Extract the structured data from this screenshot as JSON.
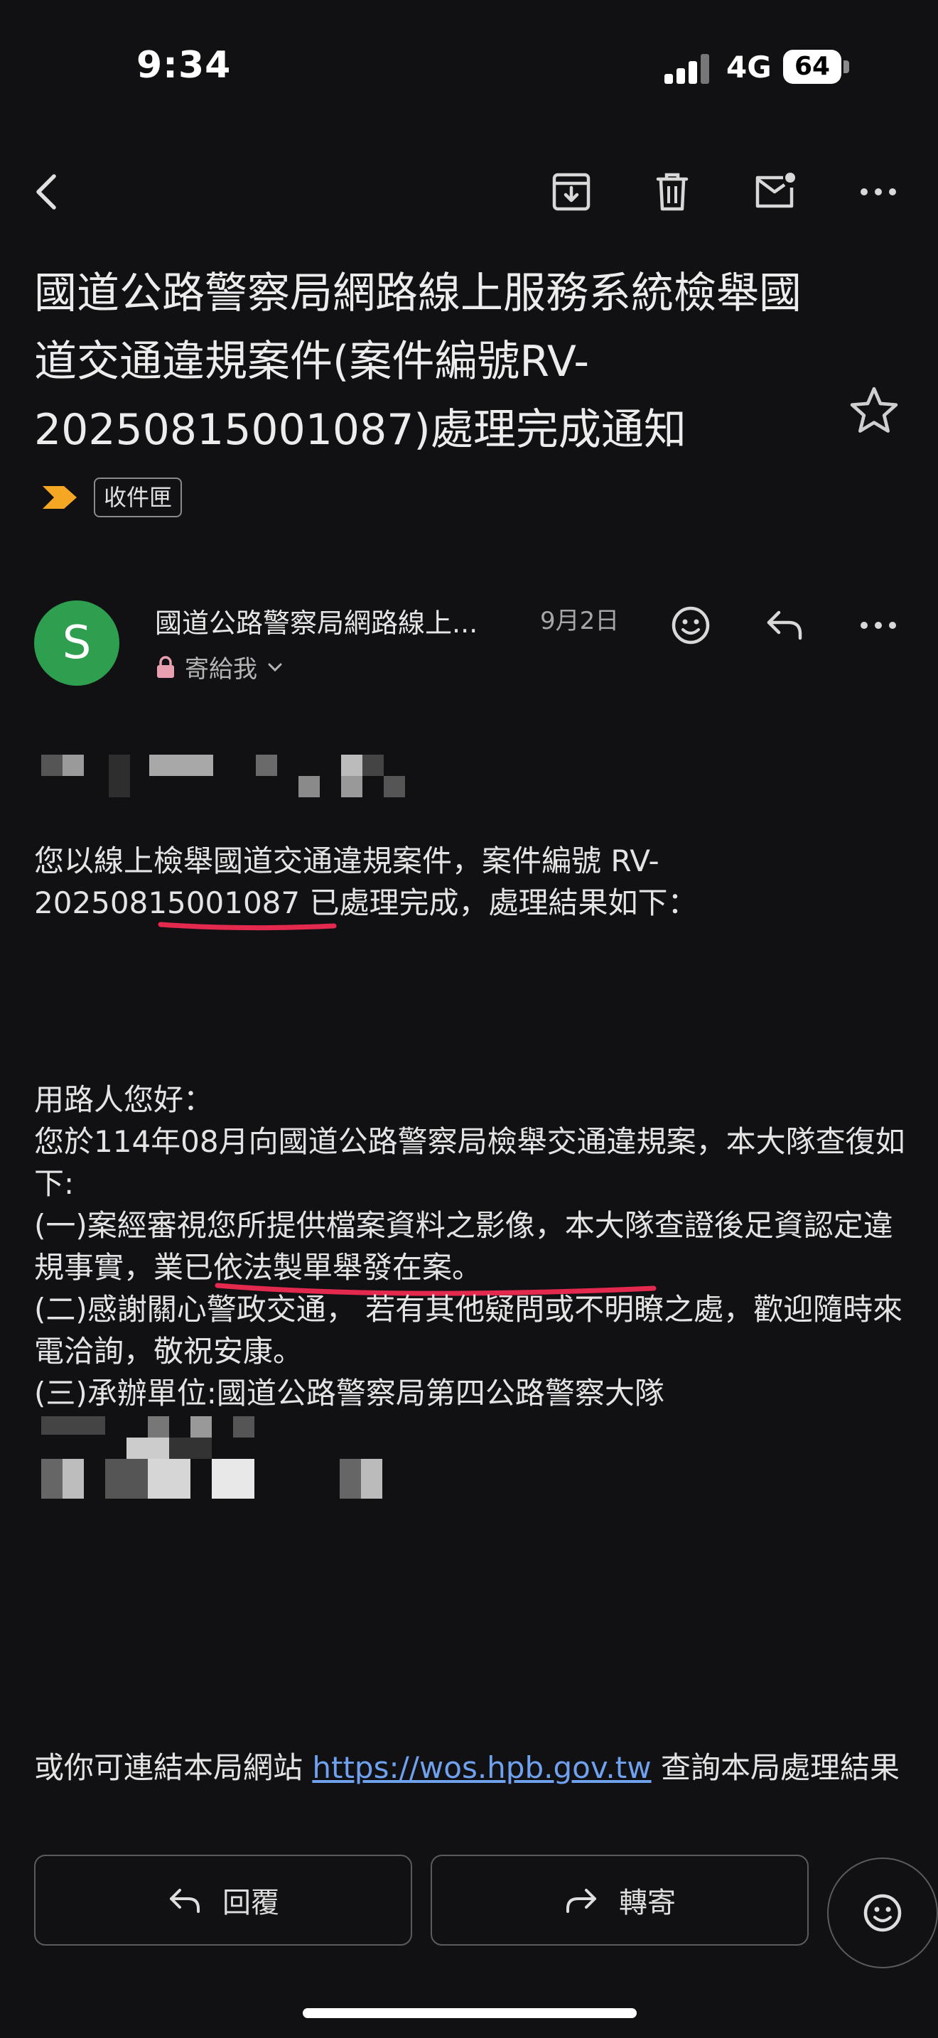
{
  "status_bar": {
    "time": "9:34",
    "network": "4G",
    "battery": "64"
  },
  "email": {
    "subject": "國道公路警察局網路線上服務系統檢舉國道交通違規案件(案件編號RV-20250815001087)處理完成通知",
    "label": "收件匣",
    "sender_initial": "S",
    "sender_name": "國道公路警察局網路線上...",
    "date": "9月2日",
    "recipient": "寄給我",
    "body": {
      "intro": "您以線上檢舉國道交通違規案件，案件編號 RV-20250815001087 已處理完成，處理結果如下：",
      "greeting": "用路人您好：",
      "p1": "您於114年08月向國道公路警察局檢舉交通違規案，本大隊查復如下:",
      "p2": "(一)案經審視您所提供檔案資料之影像，本大隊查證後足資認定違規事實，業已依法製單舉發在案。",
      "p3": "(二)感謝關心警政交通， 若有其他疑問或不明瞭之處，歡迎隨時來電洽詢，敬祝安康。",
      "p4": "(三)承辦單位:國道公路警察局第四公路警察大隊",
      "footer_prefix": "或你可連結本局網站 ",
      "footer_link": "https://wos.hpb.gov.tw",
      "footer_suffix": " 查詢本局處理結果"
    }
  },
  "buttons": {
    "reply": "回覆",
    "forward": "轉寄"
  },
  "colors": {
    "background": "#111114",
    "avatar": "#2e9e4f",
    "link": "#6fa1ef",
    "annotation": "#e3294d",
    "label_marker": "#f5a623"
  }
}
